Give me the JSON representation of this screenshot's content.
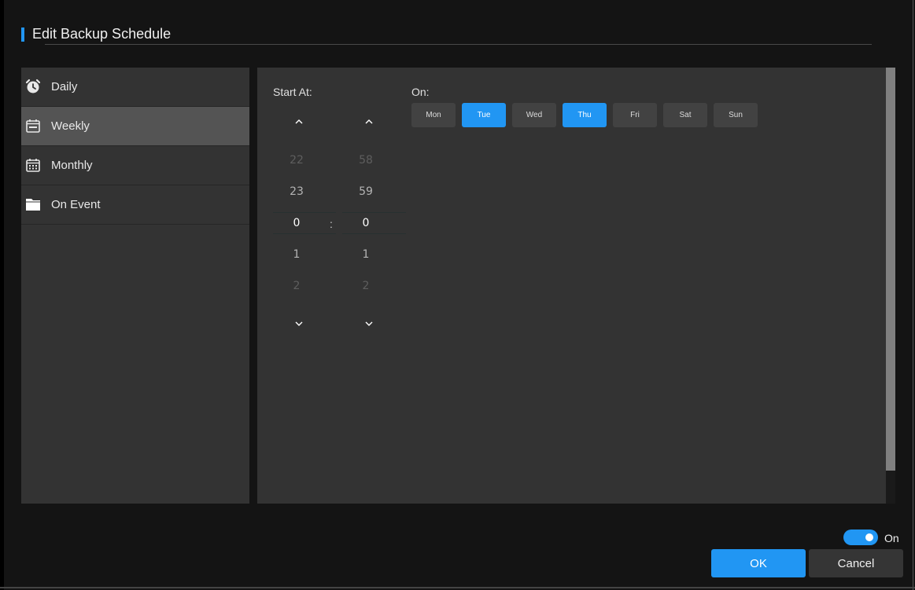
{
  "dialog": {
    "title": "Edit Backup Schedule",
    "accent_color": "#2196f3"
  },
  "sidebar": {
    "items": [
      {
        "label": "Daily",
        "icon": "alarm-clock-icon",
        "selected": false
      },
      {
        "label": "Weekly",
        "icon": "calendar-week-icon",
        "selected": true
      },
      {
        "label": "Monthly",
        "icon": "calendar-month-icon",
        "selected": false
      },
      {
        "label": "On Event",
        "icon": "folder-icon",
        "selected": false
      }
    ]
  },
  "schedule": {
    "start_at_label": "Start At:",
    "on_label": "On:",
    "separator": ":",
    "hour_picker": {
      "values": [
        "22",
        "23",
        "0",
        "1",
        "2"
      ],
      "selected": "0"
    },
    "minute_picker": {
      "values": [
        "58",
        "59",
        "0",
        "1",
        "2"
      ],
      "selected": "0"
    },
    "days": [
      {
        "label": "Mon",
        "selected": false
      },
      {
        "label": "Tue",
        "selected": true
      },
      {
        "label": "Wed",
        "selected": false
      },
      {
        "label": "Thu",
        "selected": true
      },
      {
        "label": "Fri",
        "selected": false
      },
      {
        "label": "Sat",
        "selected": false
      },
      {
        "label": "Sun",
        "selected": false
      }
    ]
  },
  "footer": {
    "toggle_label": "On",
    "toggle_state": true,
    "ok_label": "OK",
    "cancel_label": "Cancel"
  }
}
